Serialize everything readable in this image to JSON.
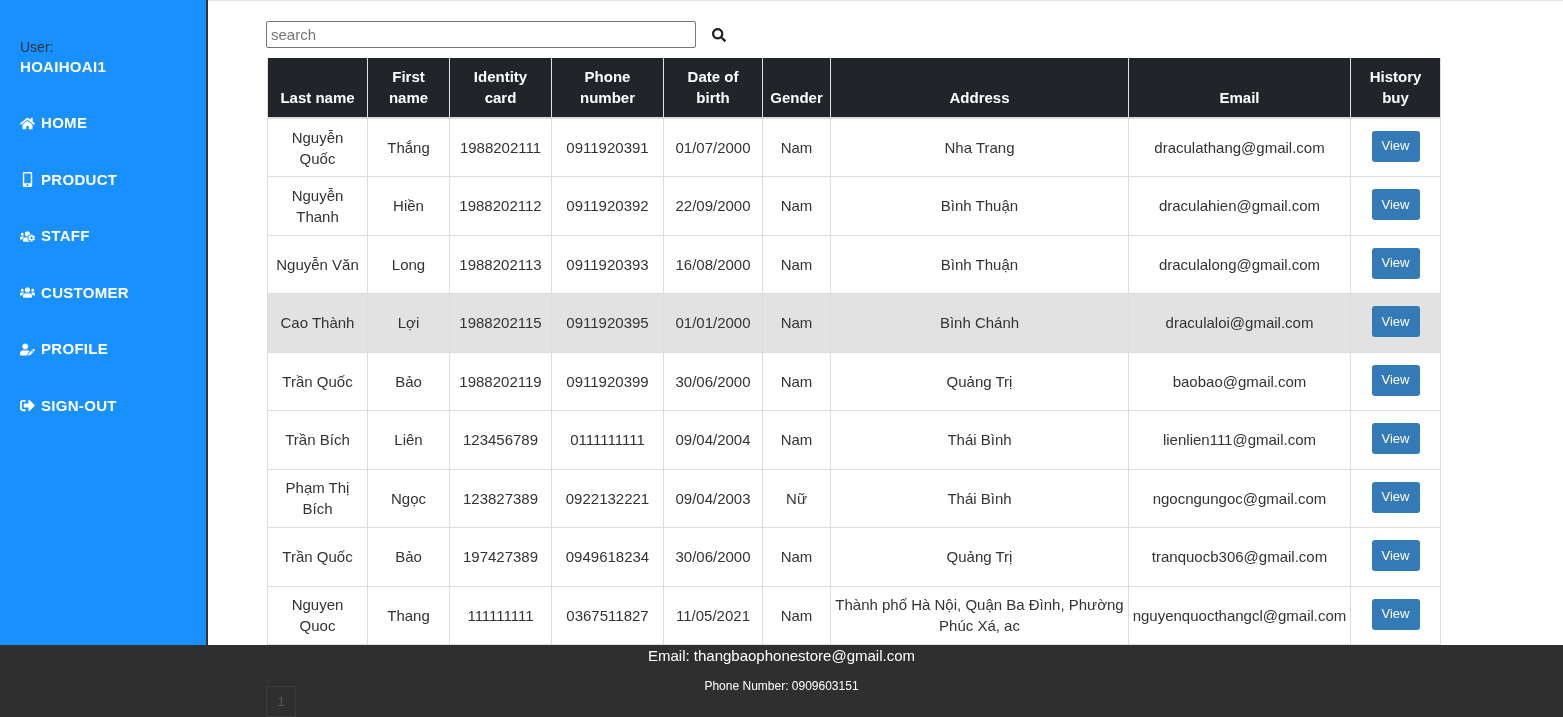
{
  "sidebar": {
    "user_label": "User:",
    "username": "HOAIHOAI1",
    "items": [
      {
        "label": "HOME"
      },
      {
        "label": "PRODUCT"
      },
      {
        "label": "STAFF"
      },
      {
        "label": "CUSTOMER"
      },
      {
        "label": "PROFILE"
      },
      {
        "label": "SIGN-OUT"
      }
    ]
  },
  "search": {
    "placeholder": "search"
  },
  "table": {
    "columns": [
      "Last name",
      "First name",
      "Identity card",
      "Phone number",
      "Date of birth",
      "Gender",
      "Address",
      "Email",
      "History buy"
    ],
    "rows": [
      {
        "selected": false,
        "cells": [
          "Nguyễn Quốc",
          "Thắng",
          "1988202111",
          "0911920391",
          "01/07/2000",
          "Nam",
          "Nha Trang",
          "draculathang@gmail.com"
        ],
        "action": "View"
      },
      {
        "selected": false,
        "cells": [
          "Nguyễn Thanh",
          "Hiền",
          "1988202112",
          "0911920392",
          "22/09/2000",
          "Nam",
          "Bình Thuận",
          "draculahien@gmail.com"
        ],
        "action": "View"
      },
      {
        "selected": false,
        "cells": [
          "Nguyễn Văn",
          "Long",
          "1988202113",
          "0911920393",
          "16/08/2000",
          "Nam",
          "Bình Thuận",
          "draculalong@gmail.com"
        ],
        "action": "View"
      },
      {
        "selected": true,
        "cells": [
          "Cao Thành",
          "Lợi",
          "1988202115",
          "0911920395",
          "01/01/2000",
          "Nam",
          "Bình Chánh",
          "draculaloi@gmail.com"
        ],
        "action": "View"
      },
      {
        "selected": false,
        "cells": [
          "Trần Quốc",
          "Bảo",
          "1988202119",
          "0911920399",
          "30/06/2000",
          "Nam",
          "Quảng Trị",
          "baobao@gmail.com"
        ],
        "action": "View"
      },
      {
        "selected": false,
        "cells": [
          "Trần Bích",
          "Liên",
          "123456789",
          "0111111111",
          "09/04/2004",
          "Nam",
          "Thái Bình",
          "lienlien111@gmail.com"
        ],
        "action": "View"
      },
      {
        "selected": false,
        "cells": [
          "Phạm Thị Bích",
          "Ngọc",
          "123827389",
          "0922132221",
          "09/04/2003",
          "Nữ",
          "Thái Bình",
          "ngocngungoc@gmail.com"
        ],
        "action": "View"
      },
      {
        "selected": false,
        "cells": [
          "Trần Quốc",
          "Bảo",
          "197427389",
          "0949618234",
          "30/06/2000",
          "Nam",
          "Quảng Trị",
          "tranquocb306@gmail.com"
        ],
        "action": "View"
      },
      {
        "selected": false,
        "cells": [
          "Nguyen Quoc",
          "Thang",
          "111111111",
          "0367511827",
          "11/05/2021",
          "Nam",
          "Thành phố Hà Nội, Quận Ba Đình, Phường Phúc Xá, ac",
          "nguyenquocthangcl@gmail.com"
        ],
        "action": "View"
      }
    ]
  },
  "pagination": [
    {
      "label": "1"
    }
  ],
  "footer": {
    "email": "Email: thangbaophonestore@gmail.com",
    "phone": "Phone Number: 0909603151"
  }
}
